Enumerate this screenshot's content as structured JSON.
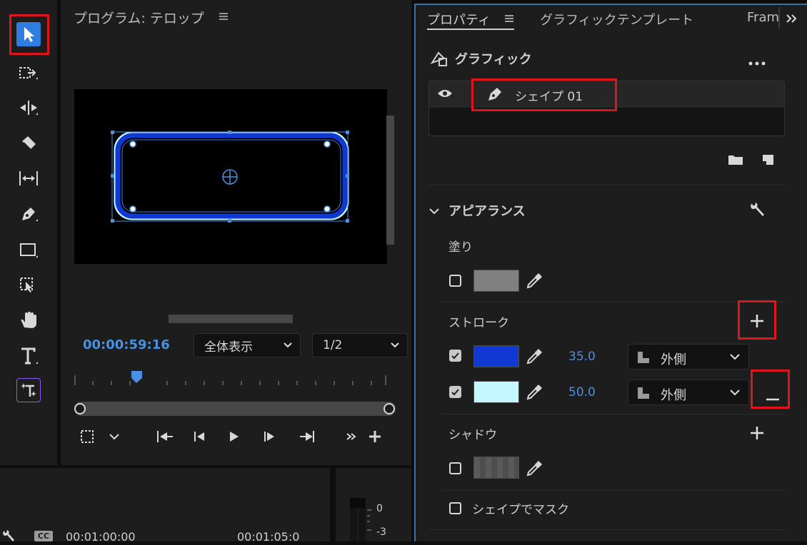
{
  "monitor": {
    "title": "プログラム: テロップ",
    "timecode": "00:00:59:16",
    "zoom_select": "全体表示",
    "resolution_select": "1/2"
  },
  "properties": {
    "tabs": [
      "プロパティ",
      "グラフィックテンプレート",
      "Fram"
    ],
    "section_graphic": "グラフィック",
    "layer_name": "シェイプ 01",
    "appearance": "アピアランス",
    "fill": {
      "label": "塗り",
      "checked": false,
      "color": "#808080"
    },
    "stroke": {
      "label": "ストローク",
      "items": [
        {
          "checked": true,
          "color": "#1238d4",
          "width": "35.0",
          "position": "外側"
        },
        {
          "checked": true,
          "color": "#c4f6ff",
          "width": "50.0",
          "position": "外側"
        }
      ]
    },
    "shadow": {
      "label": "シャドウ",
      "checked": false
    },
    "mask": {
      "label": "シェイプでマスク",
      "checked": false
    }
  },
  "timeline": {
    "time_a": "00:01:00:00",
    "time_b": "00:01:05:0",
    "cc_label": "CC"
  },
  "meter": {
    "labels": [
      "0",
      "-3"
    ]
  },
  "colors": {
    "accent_blue": "#4a90e2",
    "highlight_red": "#e0141b"
  }
}
